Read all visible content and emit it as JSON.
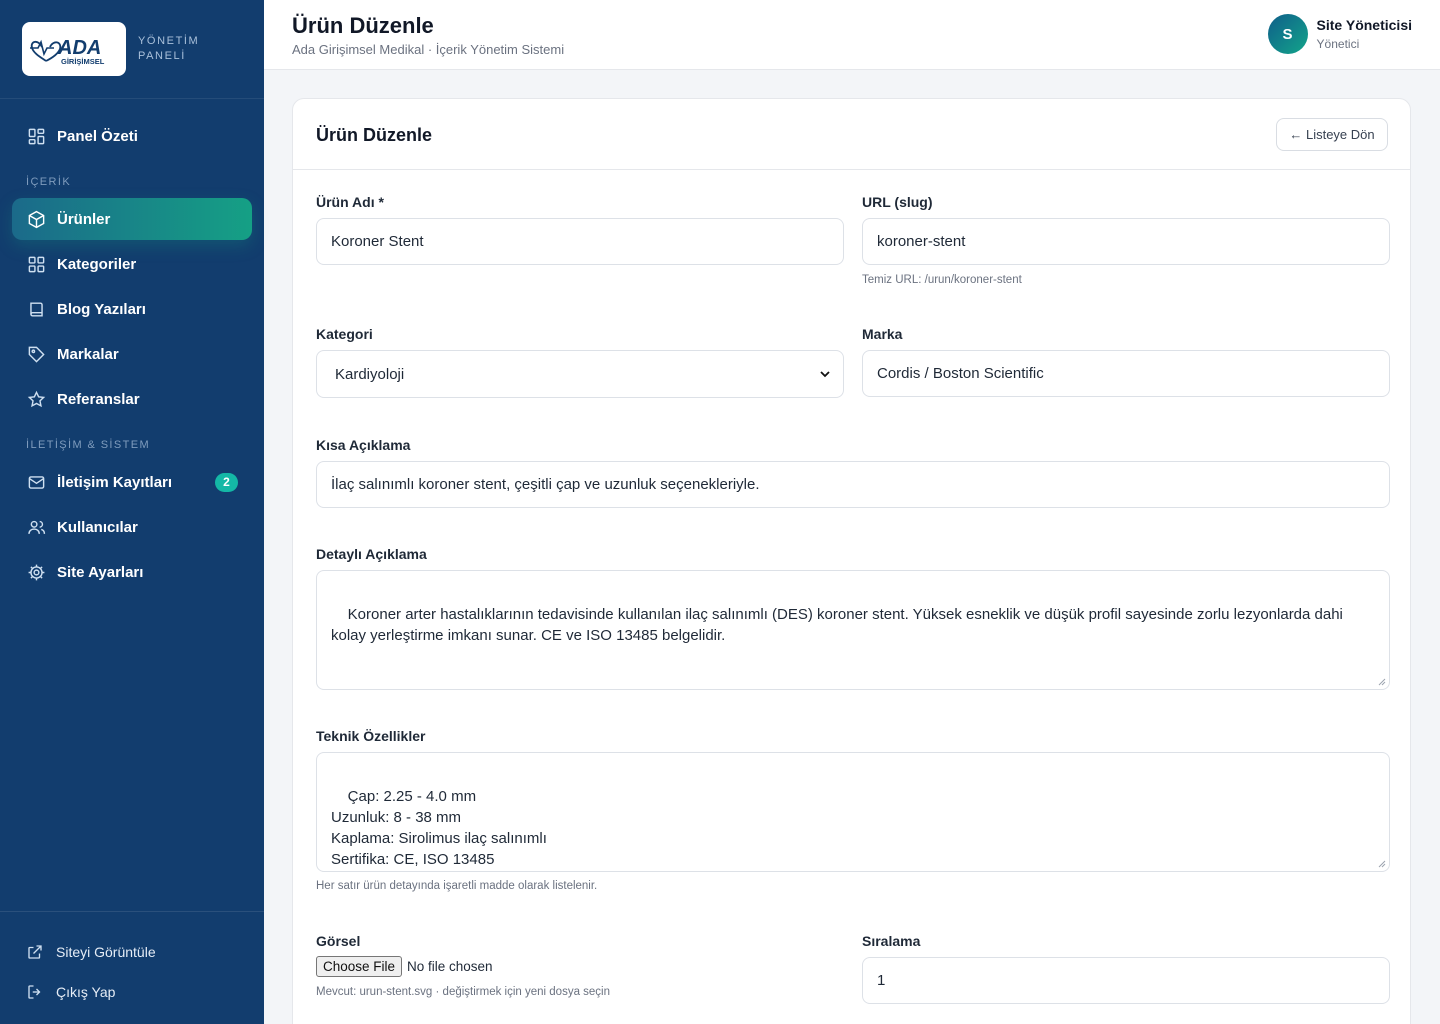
{
  "brand": {
    "logo_text": "ADA",
    "logo_subtext": "GİRİŞİMSEL",
    "panel_label_line1": "YÖNETİM",
    "panel_label_line2": "PANELİ"
  },
  "sidebar": {
    "items": [
      {
        "label": "Panel Özeti",
        "icon": "dashboard-grid-icon"
      },
      {
        "label": "Ürünler",
        "icon": "box-icon",
        "active": true
      },
      {
        "label": "Kategoriler",
        "icon": "grid-icon"
      },
      {
        "label": "Blog Yazıları",
        "icon": "book-icon"
      },
      {
        "label": "Markalar",
        "icon": "tag-icon"
      },
      {
        "label": "Referanslar",
        "icon": "star-icon"
      },
      {
        "label": "İletişim Kayıtları",
        "icon": "mail-icon",
        "badge": "2"
      },
      {
        "label": "Kullanıcılar",
        "icon": "users-icon"
      },
      {
        "label": "Site Ayarları",
        "icon": "gear-icon"
      }
    ],
    "sections": {
      "content": "İÇERİK",
      "system": "İLETİŞİM & SİSTEM"
    },
    "footer": {
      "view_site": "Siteyi Görüntüle",
      "logout": "Çıkış Yap"
    }
  },
  "header": {
    "title": "Ürün Düzenle",
    "subtitle": "Ada Girişimsel Medikal · İçerik Yönetim Sistemi",
    "user": {
      "initial": "S",
      "name": "Site Yöneticisi",
      "role": "Yönetici"
    }
  },
  "form": {
    "title": "Ürün Düzenle",
    "back_label": "← Listeye Dön",
    "name": {
      "label": "Ürün Adı *",
      "value": "Koroner Stent"
    },
    "slug": {
      "label": "URL (slug)",
      "value": "koroner-stent",
      "hint": "Temiz URL: /urun/koroner-stent"
    },
    "category": {
      "label": "Kategori",
      "value": "Kardiyoloji"
    },
    "brand": {
      "label": "Marka",
      "value": "Cordis / Boston Scientific"
    },
    "short_desc": {
      "label": "Kısa Açıklama",
      "value": "İlaç salınımlı koroner stent, çeşitli çap ve uzunluk seçenekleriyle."
    },
    "long_desc": {
      "label": "Detaylı Açıklama",
      "value": "Koroner arter hastalıklarının tedavisinde kullanılan ilaç salınımlı (DES) koroner stent. Yüksek esneklik ve düşük profil sayesinde zorlu lezyonlarda dahi kolay yerleştirme imkanı sunar. CE ve ISO 13485 belgelidir."
    },
    "specs": {
      "label": "Teknik Özellikler",
      "value": "Çap: 2.25 - 4.0 mm\nUzunluk: 8 - 38 mm\nKaplama: Sirolimus ilaç salınımlı\nSertifika: CE, ISO 13485",
      "hint": "Her satır ürün detayında işaretli madde olarak listelenir."
    },
    "image": {
      "label": "Görsel",
      "button": "Choose File",
      "status": "No file chosen",
      "hint": "Mevcut: urun-stent.svg · değiştirmek için yeni dosya seçin"
    },
    "order": {
      "label": "Sıralama",
      "value": "1"
    }
  }
}
